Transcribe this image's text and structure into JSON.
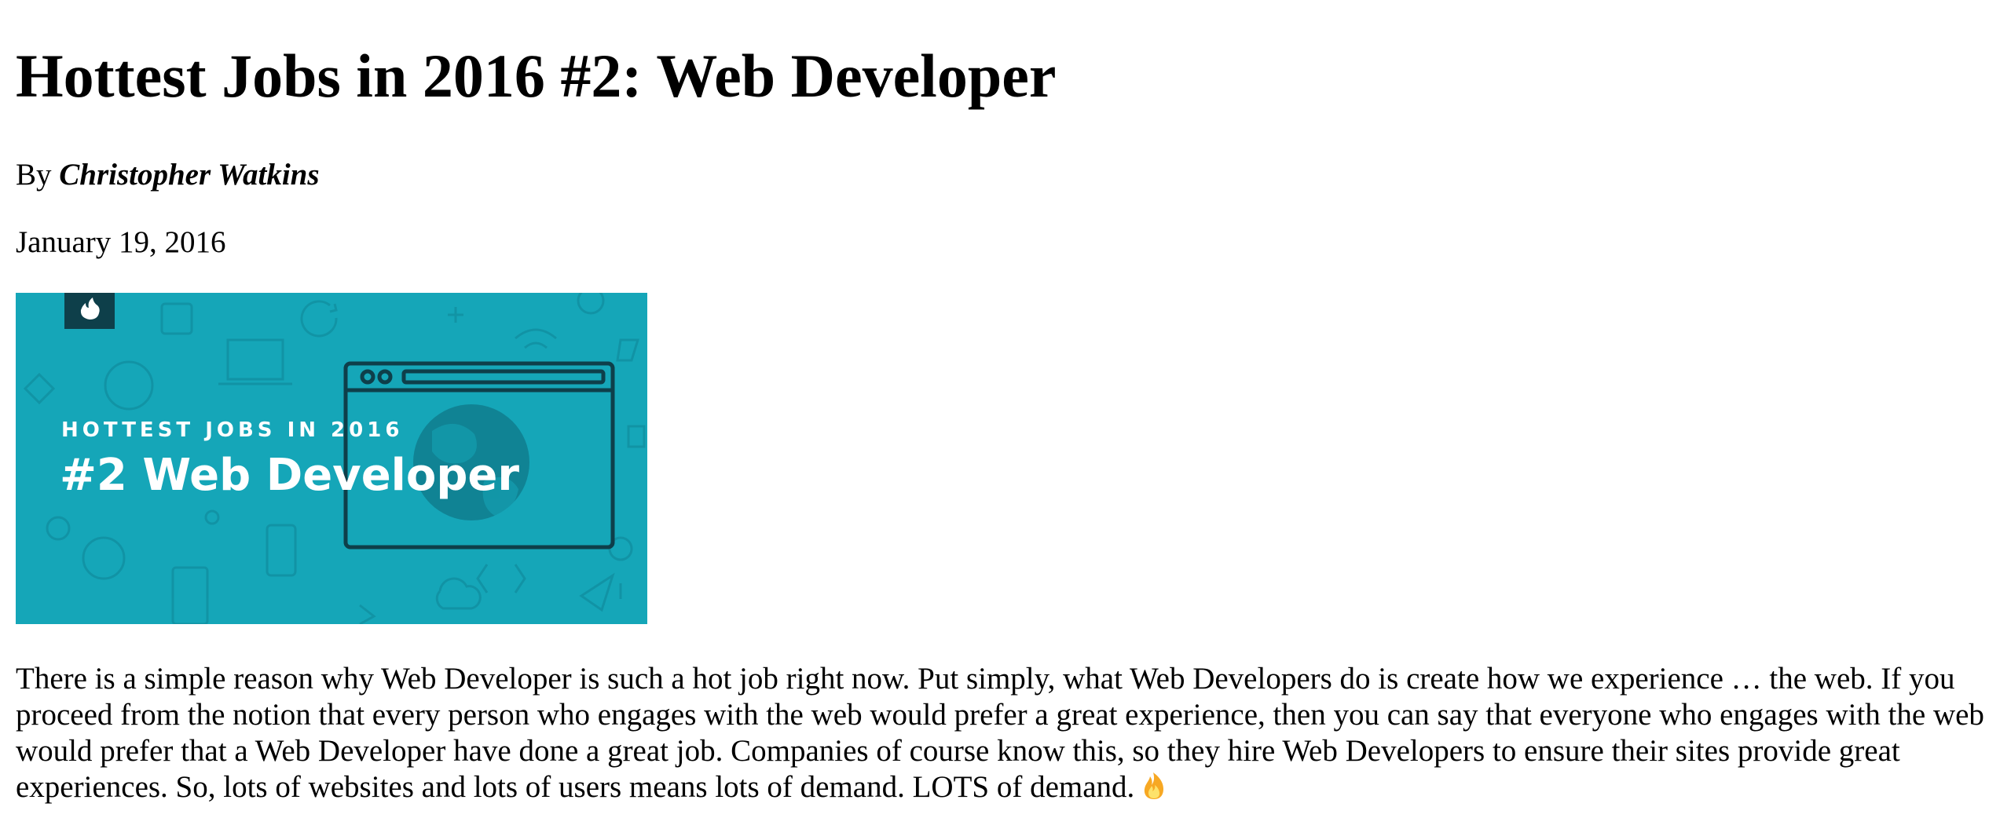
{
  "article": {
    "title": "Hottest Jobs in 2016 #2: Web Developer",
    "byline_prefix": "By ",
    "author": "Christopher Watkins",
    "date": "January 19, 2016",
    "hero_image": {
      "kicker": "HOTTEST JOBS IN 2016",
      "headline": "#2 Web Developer",
      "badge_icon": "flame-icon",
      "background_color": "#15a6b8",
      "badge_color": "#0e3f4a",
      "line_color": "#0e3f4a"
    },
    "body": "There is a simple reason why Web Developer is such a hot job right now. Put simply, what Web Developers do is create how we experience … the web. If you proceed from the notion that every person who engages with the web would prefer a great experience, then you can say that everyone who engages with the web would prefer that a Web Developer have done a great job. Companies of course know this, so they hire Web Developers to ensure their sites provide great experiences. So, lots of websites and lots of users means lots of demand. LOTS of demand.",
    "body_end_icon": "fire-emoji-icon"
  }
}
